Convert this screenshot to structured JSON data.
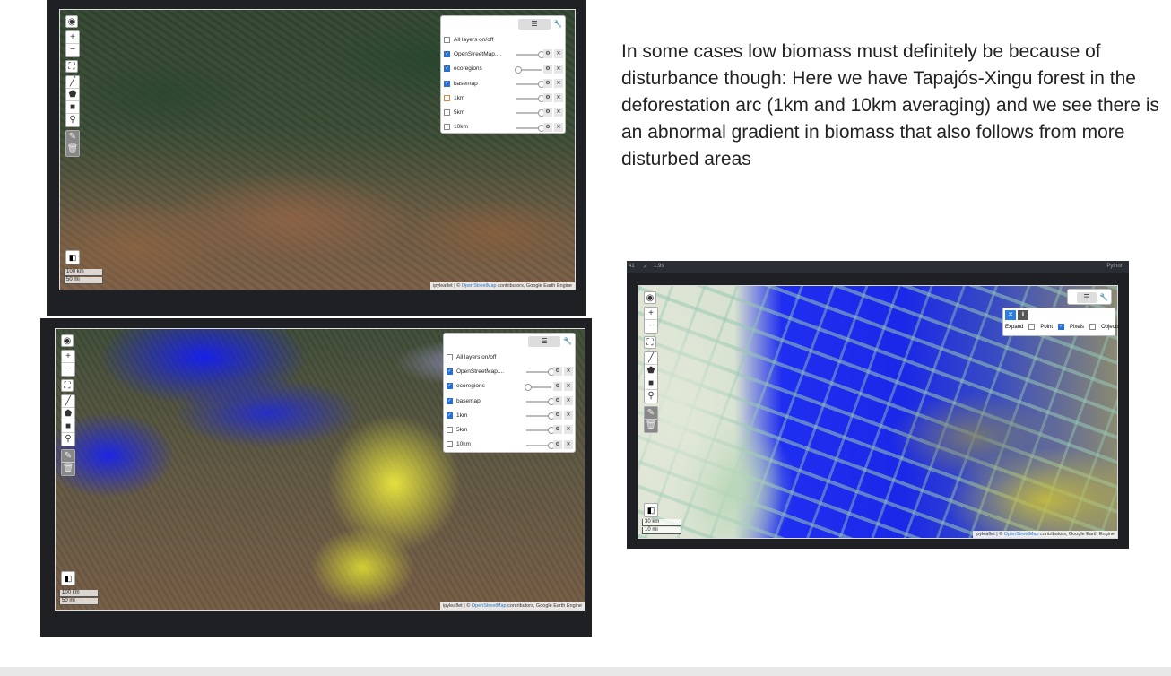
{
  "caption": "In some cases low biomass must definitely be because of disturbance though: Here we have Tapajós-Xingu forest in the deforestation arc (1km and 10km averaging) and we see there is an abnormal gradient in biomass that also follows from more disturbed areas",
  "icons": {
    "globe": "globe-icon",
    "zoom_in": "+",
    "zoom_out": "-",
    "fullscreen": "fullscreen-icon",
    "line": "draw-line-icon",
    "polygon": "draw-polygon-icon",
    "rect": "draw-rectangle-icon",
    "marker": "draw-marker-icon",
    "edit": "edit-icon",
    "delete": "trash-icon",
    "layers": "layers-icon",
    "wrench": "wrench-icon",
    "gear": "gear-icon",
    "close": "close-icon"
  },
  "map1": {
    "layers": [
      {
        "label": "All layers on/off",
        "checked": false,
        "slider": false
      },
      {
        "label": "OpenStreetMap....",
        "checked": true,
        "slider": true
      },
      {
        "label": "ecoregions",
        "checked": true,
        "slider": true
      },
      {
        "label": "basemap",
        "checked": true,
        "slider": true
      },
      {
        "label": "1km",
        "checked": false,
        "slider": true
      },
      {
        "label": "5km",
        "checked": false,
        "slider": true
      },
      {
        "label": "10km",
        "checked": false,
        "slider": true
      }
    ],
    "scale_km": "100 km",
    "scale_mi": "50 mi",
    "attrib_prefix": "ipyleaflet | ©",
    "attrib_link": "OpenStreetMap",
    "attrib_suffix": "contributors, Google Earth Engine"
  },
  "map2": {
    "layers": [
      {
        "label": "All layers on/off",
        "checked": false,
        "slider": false
      },
      {
        "label": "OpenStreetMap....",
        "checked": true,
        "slider": true
      },
      {
        "label": "ecoregions",
        "checked": true,
        "slider": true
      },
      {
        "label": "basemap",
        "checked": true,
        "slider": true
      },
      {
        "label": "1km",
        "checked": true,
        "slider": true
      },
      {
        "label": "5km",
        "checked": false,
        "slider": true
      },
      {
        "label": "10km",
        "checked": false,
        "slider": true
      }
    ],
    "scale_km": "100 km",
    "scale_mi": "50 mi",
    "attrib_prefix": "ipyleaflet | ©",
    "attrib_link": "OpenStreetMap",
    "attrib_suffix": "contributors, Google Earth Engine"
  },
  "map3": {
    "cell_index": "41",
    "run_status": "✓",
    "exec_time": "1.9s",
    "language": "Python",
    "toolbar": {
      "expand": "Expand",
      "point": "Point",
      "pixels": "Pixels",
      "objects": "Objects",
      "pixels_checked": true
    },
    "scale_km": "30 km",
    "scale_mi": "10 mi",
    "attrib_prefix": "ipyleaflet | ©",
    "attrib_link": "OpenStreetMap",
    "attrib_suffix": "contributors, Google Earth Engine"
  }
}
